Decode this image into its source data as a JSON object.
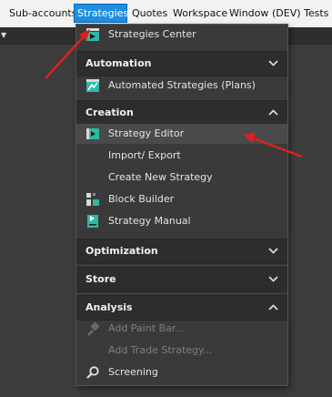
{
  "menubar": {
    "items": [
      "Sub-accounts",
      "Strategies",
      "Quotes",
      "Workspace",
      "Window",
      "(DEV) Tests"
    ],
    "active_index": 1
  },
  "dropdown": {
    "strategies_center": "Strategies Center",
    "sections": {
      "automation": {
        "title": "Automation",
        "state": "expanded"
      },
      "creation": {
        "title": "Creation",
        "state": "expanded"
      },
      "optimization": {
        "title": "Optimization",
        "state": "collapsed"
      },
      "store": {
        "title": "Store",
        "state": "collapsed"
      },
      "analysis": {
        "title": "Analysis",
        "state": "expanded"
      }
    },
    "items": {
      "automated_strategies": "Automated Strategies (Plans)",
      "strategy_editor": "Strategy Editor",
      "import_export": "Import/ Export",
      "create_new_strategy": "Create New Strategy",
      "block_builder": "Block Builder",
      "strategy_manual": "Strategy Manual",
      "add_paint_bar": "Add Paint Bar...",
      "add_trade_strategy": "Add Trade Strategy...",
      "screening": "Screening"
    }
  },
  "colors": {
    "menu_active": "#1e8ee0",
    "section_bg": "#2d2d2d",
    "menu_bg": "#3a3a3a",
    "annotation_arrow": "#e02020",
    "icon_teal": "#2fb8a8"
  }
}
